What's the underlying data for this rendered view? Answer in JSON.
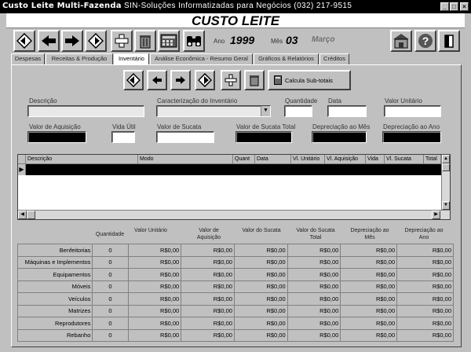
{
  "window": {
    "title": "Custo Leite Multi-Fazenda",
    "subtitle": "SIN-Soluções Informatizadas para Negócios (032) 217-9515"
  },
  "banner": "CUSTO LEITE",
  "toolbar": {
    "ano_label": "Ano",
    "ano": "1999",
    "mes_label": "Mês",
    "mes": "03",
    "mes_nome": "Março"
  },
  "tabs": [
    "Despesas",
    "Receitas & Produção",
    "Inventário",
    "Análise Econômica - Resumo Geral",
    "Gráficos & Relatórios",
    "Créditos"
  ],
  "sub_toolbar": {
    "calc_label": "Calcula Sub-totais"
  },
  "form": {
    "descricao": "Descrição",
    "caracterizacao": "Caracterização do Inventário",
    "quantidade": "Quantidade",
    "data": "Data",
    "valor_unitario": "Valor Unitário",
    "valor_aquisicao": "Valor de Aquisição",
    "vida_util": "Vida Útil",
    "valor_sucata": "Valor de Sucata",
    "valor_sucata_total": "Valor de Sucata Total",
    "depreciacao_mes": "Depreciação ao Mês",
    "depreciacao_ano": "Depreciação ao Ano"
  },
  "grid": {
    "columns": [
      "Descrição",
      "Modo",
      "Quant",
      "Data",
      "Vl. Unitário",
      "Vl. Aquisição",
      "Vida",
      "Vl. Sucata",
      "Total"
    ]
  },
  "summary": {
    "headers": [
      "Quantidade",
      "Valor Unitário",
      "Valor de Aquisição",
      "Valor do Sucata",
      "Valor do Sucata Total",
      "Depreciação ao Mês",
      "Depreciação ao Ano"
    ],
    "rows": [
      {
        "name": "Benfeitorias",
        "qty": "0",
        "v": [
          "R$0,00",
          "R$0,00",
          "R$0,00",
          "R$0,00",
          "R$0,00",
          "R$0,00"
        ]
      },
      {
        "name": "Máquinas e Implementos",
        "qty": "0",
        "v": [
          "R$0,00",
          "R$0,00",
          "R$0,00",
          "R$0,00",
          "R$0,00",
          "R$0,00"
        ]
      },
      {
        "name": "Equipamentos",
        "qty": "0",
        "v": [
          "R$0,00",
          "R$0,00",
          "R$0,00",
          "R$0,00",
          "R$0,00",
          "R$0,00"
        ]
      },
      {
        "name": "Móveis",
        "qty": "0",
        "v": [
          "R$0,00",
          "R$0,00",
          "R$0,00",
          "R$0,00",
          "R$0,00",
          "R$0,00"
        ]
      },
      {
        "name": "Veículos",
        "qty": "0",
        "v": [
          "R$0,00",
          "R$0,00",
          "R$0,00",
          "R$0,00",
          "R$0,00",
          "R$0,00"
        ]
      },
      {
        "name": "Matrizes",
        "qty": "0",
        "v": [
          "R$0,00",
          "R$0,00",
          "R$0,00",
          "R$0,00",
          "R$0,00",
          "R$0,00"
        ]
      },
      {
        "name": "Reprodutores",
        "qty": "0",
        "v": [
          "R$0,00",
          "R$0,00",
          "R$0,00",
          "R$0,00",
          "R$0,00",
          "R$0,00"
        ]
      },
      {
        "name": "Rebanho",
        "qty": "0",
        "v": [
          "R$0,00",
          "R$0,00",
          "R$0,00",
          "R$0,00",
          "R$0,00",
          "R$0,00"
        ]
      }
    ]
  }
}
